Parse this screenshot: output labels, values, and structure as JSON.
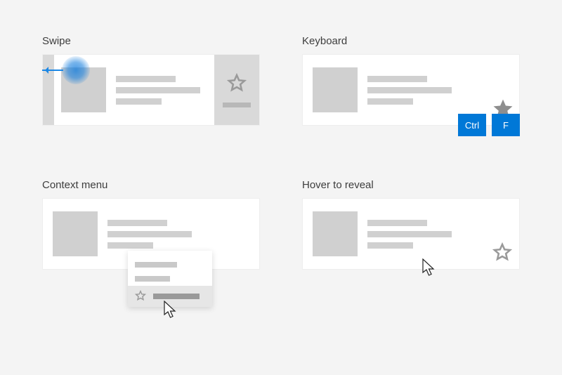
{
  "swipe": {
    "label": "Swipe"
  },
  "keyboard": {
    "label": "Keyboard",
    "key_ctrl": "Ctrl",
    "key_f": "F"
  },
  "context": {
    "label": "Context menu"
  },
  "hover": {
    "label": "Hover to reveal"
  }
}
